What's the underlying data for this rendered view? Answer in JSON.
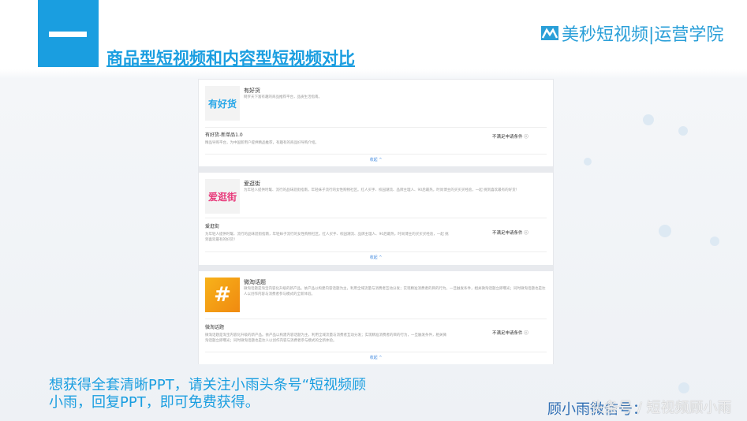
{
  "header": {
    "title": "商品型短视频和内容型短视频对比",
    "logo_brand": "美秒短视频",
    "logo_sub": "|运营学院"
  },
  "cards": [
    {
      "thumb_text": "有好货",
      "thumb_color": "#2aa7e8",
      "thumb_bg": "#f3f3f3",
      "name": "有好货",
      "desc": "网罗天下富有趣的商品推荐平台，品质生活指南。",
      "sub_title": "有好货-新单品1.0",
      "sub_desc": "精品导购平台，为中国新用户提供精品推荐，有趣有的商品好导购介绍。",
      "condition": "不满足申请条件",
      "fold": "收起 ^"
    },
    {
      "thumb_text": "爱逛街",
      "thumb_color": "#e8397a",
      "thumb_bg": "#f3f3f3",
      "name": "爱逛街",
      "desc": "为年轻人提供时髦、流行的品味逛街指南，年轻妹子流行的女性购物社区。红人买手、校园潮流、品牌主理人、90后最热，时尚博主的买买买经验，一起 挑到喜欢最有的好货！",
      "sub_title": "爱逛街",
      "sub_desc": "为年轻人提供时髦、流行的品味逛街指南，年轻妹子流行的女性购物社区。红人买手、校园潮流、品牌主理人、90后最热，时尚博主的买买买经验，一起 挑到喜欢最有的好货！",
      "condition": "不满足申请条件",
      "fold": "收起 ^"
    },
    {
      "thumb_text": "#",
      "thumb_color": "#ffffff",
      "thumb_bg": "#f5a015",
      "name": "微淘话题",
      "desc": "微淘话题是淘宝内容化升级的新产品。依产品以构建内容话题为主，利用全域流量与消费者互动分发；实现精准消费者的目的行为，一旦触发条件，相关微淘话题立即曝光；同时微淘话题也是达人以创作内容与消费者参与模式的全新体验。",
      "sub_title": "微淘话题",
      "sub_desc": "微淘话题是淘宝内容化升级的新产品。依产品以构建内容话题为主，利用全域流量与消费者互动分发；实现精准消费者的目的行为，一旦触发条件，相关微淘话题立即曝光；同时微淘话题也是达人以创作内容与消费者参与模式的全新体验。",
      "condition": "不满足申请条件",
      "fold": "收起 ^"
    }
  ],
  "footer": {
    "cta": "想获得全套清晰PPT，请关注小雨头条号“短视频顾小雨，回复PPT，即可免费获得。",
    "wechat": "顾小雨微信号：",
    "watermark": "头条号 / 短视频顾小雨"
  }
}
